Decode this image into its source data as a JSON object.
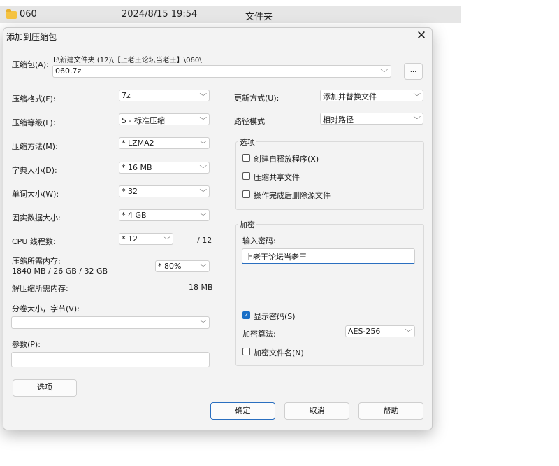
{
  "explorer": {
    "name": "060",
    "date": "2024/8/15 19:54",
    "type": "文件夹"
  },
  "dialog": {
    "title": "添加到压缩包",
    "close_label": "✕",
    "archive_label": "压缩包(A):",
    "archive_path": "I:\\新建文件夹 (12)\\【上老王论坛当老王】\\060\\",
    "archive_name": "060.7z",
    "browse_label": "...",
    "left": {
      "format_label": "压缩格式(F):",
      "format_value": "7z",
      "level_label": "压缩等级(L):",
      "level_value": "5 - 标准压缩",
      "method_label": "压缩方法(M):",
      "method_value": "* LZMA2",
      "dict_label": "字典大小(D):",
      "dict_value": "* 16 MB",
      "word_label": "单词大小(W):",
      "word_value": "* 32",
      "solid_label": "固实数据大小:",
      "solid_value": "* 4 GB",
      "cpu_label": "CPU 线程数:",
      "cpu_value": "* 12",
      "cpu_total": "/ 12",
      "mem_label": "压缩所需内存:",
      "mem_detail": "1840 MB / 26 GB / 32 GB",
      "mem_value": "* 80%",
      "decomp_label": "解压缩所需内存:",
      "decomp_value": "18 MB",
      "split_label": "分卷大小，字节(V):",
      "split_value": "",
      "params_label": "参数(P):",
      "params_value": "",
      "options_button": "选项"
    },
    "right": {
      "update_label": "更新方式(U):",
      "update_value": "添加并替换文件",
      "path_label": "路径模式",
      "path_value": "相对路径",
      "options_group": "选项",
      "opt_sfx": "创建自释放程序(X)",
      "opt_shared": "压缩共享文件",
      "opt_delete": "操作完成后删除源文件",
      "encrypt_group": "加密",
      "password_label": "输入密码:",
      "password_value": "上老王论坛当老王",
      "show_password": "显示密码(S)",
      "algo_label": "加密算法:",
      "algo_value": "AES-256",
      "encrypt_names": "加密文件名(N)"
    },
    "buttons": {
      "ok": "确定",
      "cancel": "取消",
      "help": "帮助"
    }
  }
}
